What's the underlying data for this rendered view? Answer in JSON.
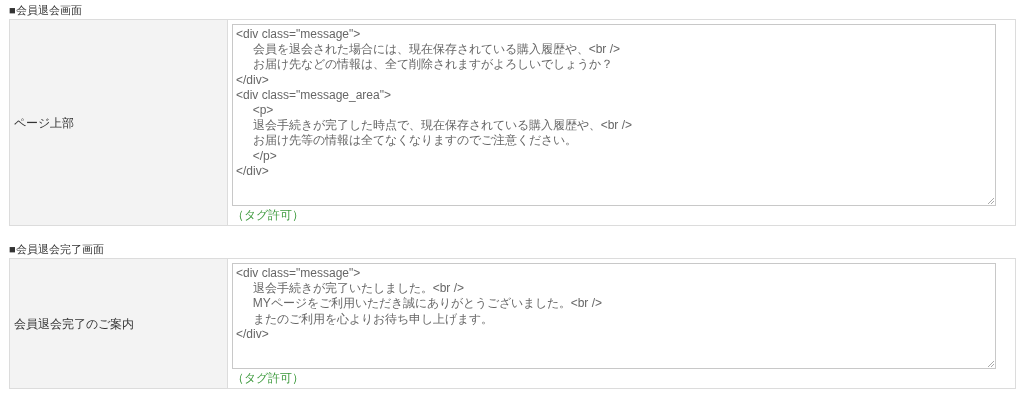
{
  "sections": [
    {
      "heading": "■会員退会画面",
      "label": "ページ上部",
      "value": "<div class=\"message\">\n\t会員を退会された場合には、現在保存されている購入履歴や、<br />\n\tお届け先などの情報は、全て削除されますがよろしいでしょうか？\n</div>\n<div class=\"message_area\">\n\t<p>\n\t退会手続きが完了した時点で、現在保存されている購入履歴や、<br />\n\tお届け先等の情報は全てなくなりますのでご注意ください。\n\t</p>\n</div>",
      "note": "（タグ許可）"
    },
    {
      "heading": "■会員退会完了画面",
      "label": "会員退会完了のご案内",
      "value": "<div class=\"message\">\n\t退会手続きが完了いたしました。<br />\n\tMYページをご利用いただき誠にありがとうございました。<br />\n\tまたのご利用を心よりお待ち申し上げます。\n</div>",
      "note": "（タグ許可）"
    }
  ]
}
